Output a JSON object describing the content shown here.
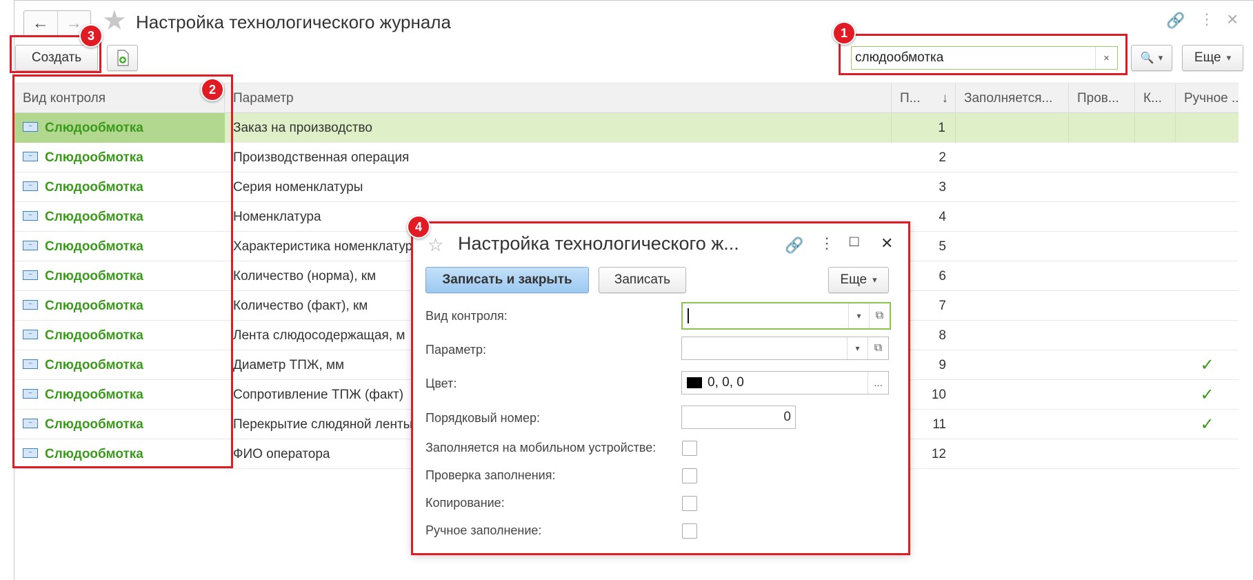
{
  "header": {
    "title": "Настройка технологического журнала",
    "back_icon": "←",
    "forward_icon": "→",
    "star_icon": "★",
    "link_icon": "🔗",
    "more_icon": "⋮",
    "close_icon": "×"
  },
  "toolbar": {
    "create_label": "Создать",
    "search_value": "слюдообмотка",
    "clear_icon": "×",
    "search_icon": "🔍",
    "dropdown_arrow": "▾",
    "more_label": "Еще"
  },
  "table": {
    "columns": [
      "Вид контроля",
      "Параметр",
      "П...",
      "Заполняется...",
      "Пров...",
      "К...",
      "Ручное ..."
    ],
    "sort_icon": "↓",
    "rows": [
      {
        "kind": "Слюдообмотка",
        "param": "Заказ на производство",
        "num": "1",
        "manual": ""
      },
      {
        "kind": "Слюдообмотка",
        "param": "Производственная операция",
        "num": "2",
        "manual": ""
      },
      {
        "kind": "Слюдообмотка",
        "param": "Серия номенклатуры",
        "num": "3",
        "manual": ""
      },
      {
        "kind": "Слюдообмотка",
        "param": "Номенклатура",
        "num": "4",
        "manual": ""
      },
      {
        "kind": "Слюдообмотка",
        "param": "Характеристика номенклатуры",
        "num": "5",
        "manual": ""
      },
      {
        "kind": "Слюдообмотка",
        "param": "Количество (норма), км",
        "num": "6",
        "manual": ""
      },
      {
        "kind": "Слюдообмотка",
        "param": "Количество (факт), км",
        "num": "7",
        "manual": ""
      },
      {
        "kind": "Слюдообмотка",
        "param": "Лента слюдосодержащая, м",
        "num": "8",
        "manual": ""
      },
      {
        "kind": "Слюдообмотка",
        "param": "Диаметр ТПЖ, мм",
        "num": "9",
        "manual": "✓"
      },
      {
        "kind": "Слюдообмотка",
        "param": "Сопротивление ТПЖ (факт)",
        "num": "10",
        "manual": "✓"
      },
      {
        "kind": "Слюдообмотка",
        "param": "Перекрытие слюдяной ленты",
        "num": "11",
        "manual": "✓"
      },
      {
        "kind": "Слюдообмотка",
        "param": "ФИО оператора",
        "num": "12",
        "manual": ""
      }
    ]
  },
  "callouts": {
    "one": "1",
    "two": "2",
    "three": "3",
    "four": "4"
  },
  "dialog": {
    "title": "Настройка технологического ж...",
    "star_icon": "☆",
    "link_icon": "🔗",
    "more_icon": "⋮",
    "maximize_icon": "□",
    "close_icon": "✕",
    "save_close_label": "Записать и закрыть",
    "save_label": "Записать",
    "more_label": "Еще",
    "dropdown_arrow": "▾",
    "open_icon": "⧉",
    "ellipsis": "...",
    "fields": {
      "kind_label": "Вид контроля:",
      "kind_value": "",
      "param_label": "Параметр:",
      "param_value": "",
      "color_label": "Цвет:",
      "color_value": "0, 0, 0",
      "order_label": "Порядковый номер:",
      "order_value": "0",
      "mobile_label": "Заполняется на мобильном устройстве:",
      "check_label": "Проверка заполнения:",
      "copy_label": "Копирование:",
      "manual_label": "Ручное заполнение:"
    }
  },
  "colors": {
    "accent_red": "#e01b24",
    "kind_green": "#3b9a1c",
    "selected_row": "#dff0c8",
    "primary_button": "#a8d0f4"
  }
}
